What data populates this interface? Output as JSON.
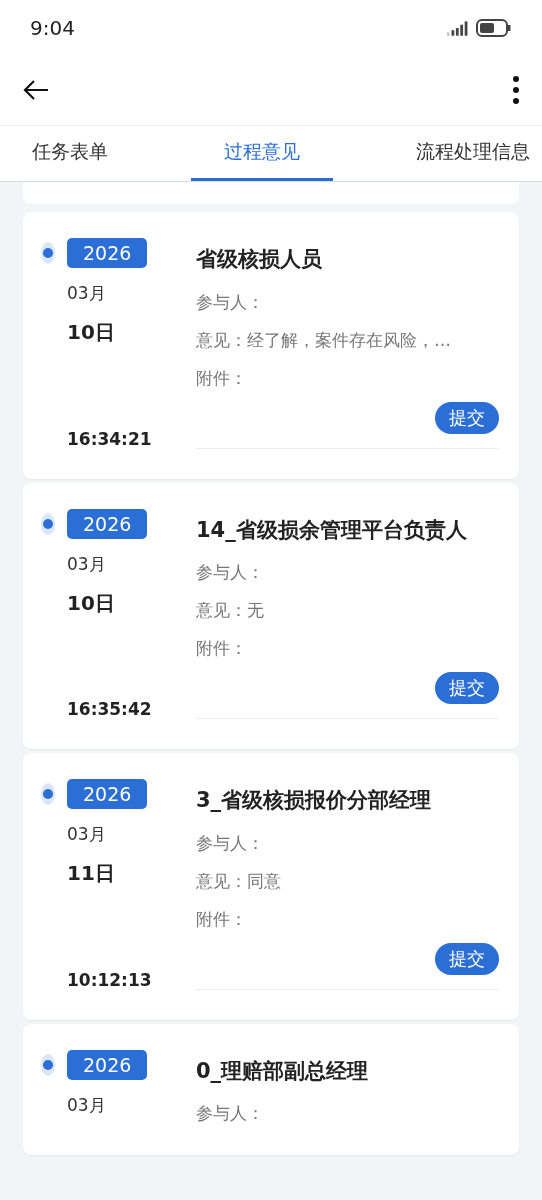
{
  "status_bar": {
    "time": "9:04"
  },
  "tabs": [
    {
      "label": "任务表单",
      "selected": false
    },
    {
      "label": "过程意见",
      "selected": true
    },
    {
      "label": "流程处理信息",
      "selected": false
    }
  ],
  "records": [
    {
      "year": "2026",
      "month": "03月",
      "day": "10日",
      "time": "16:34:21",
      "title": "省级核损人员",
      "participant": "参与人：",
      "opinion": "意见：经了解，案件存在风险，…",
      "attachment": "附件：",
      "action": "提交"
    },
    {
      "year": "2026",
      "month": "03月",
      "day": "10日",
      "time": "16:35:42",
      "title": "14_省级损余管理平台负责人",
      "participant": "参与人：",
      "opinion": "意见：无",
      "attachment": "附件：",
      "action": "提交"
    },
    {
      "year": "2026",
      "month": "03月",
      "day": "11日",
      "time": "10:12:13",
      "title": "3_省级核损报价分部经理",
      "participant": "参与人：",
      "opinion": "意见：同意",
      "attachment": "附件：",
      "action": "提交"
    },
    {
      "year": "2026",
      "month": "03月",
      "title": "0_理赔部副总经理",
      "participant": "参与人："
    }
  ]
}
